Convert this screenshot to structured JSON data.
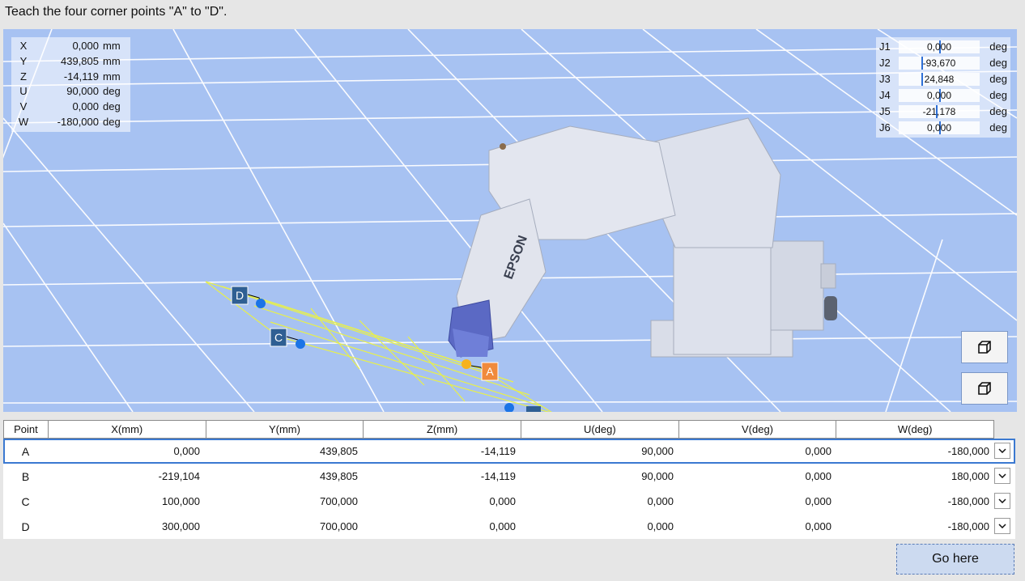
{
  "instruction": "Teach the four corner points \"A\" to \"D\".",
  "coords": [
    {
      "axis": "X",
      "value": "0,000",
      "unit": "mm"
    },
    {
      "axis": "Y",
      "value": "439,805",
      "unit": "mm"
    },
    {
      "axis": "Z",
      "value": "-14,119",
      "unit": "mm"
    },
    {
      "axis": "U",
      "value": "90,000",
      "unit": "deg"
    },
    {
      "axis": "V",
      "value": "0,000",
      "unit": "deg"
    },
    {
      "axis": "W",
      "value": "-180,000",
      "unit": "deg"
    }
  ],
  "joints": [
    {
      "name": "J1",
      "value": "0,000",
      "unit": "deg"
    },
    {
      "name": "J2",
      "value": "-93,670",
      "unit": "deg"
    },
    {
      "name": "J3",
      "value": "24,848",
      "unit": "deg"
    },
    {
      "name": "J4",
      "value": "0,000",
      "unit": "deg"
    },
    {
      "name": "J5",
      "value": "-21,178",
      "unit": "deg"
    },
    {
      "name": "J6",
      "value": "0,000",
      "unit": "deg"
    }
  ],
  "scene": {
    "robot_logo": "EPSON",
    "markers": {
      "a": "A",
      "b": "B",
      "c": "C",
      "d": "D"
    },
    "colors": {
      "background": "#a7c2f2",
      "marker_blue": "#2f5f93",
      "marker_orange": "#f08a3c",
      "plane": "#e8f04a"
    }
  },
  "view_buttons": [
    {
      "icon": "cube-icon"
    },
    {
      "icon": "cube-outline-icon"
    }
  ],
  "table": {
    "columns": [
      "Point",
      "X(mm)",
      "Y(mm)",
      "Z(mm)",
      "U(deg)",
      "V(deg)",
      "W(deg)"
    ],
    "rows": [
      {
        "point": "A",
        "x": "0,000",
        "y": "439,805",
        "z": "-14,119",
        "u": "90,000",
        "v": "0,000",
        "w": "-180,000"
      },
      {
        "point": "B",
        "x": "-219,104",
        "y": "439,805",
        "z": "-14,119",
        "u": "90,000",
        "v": "0,000",
        "w": "180,000"
      },
      {
        "point": "C",
        "x": "100,000",
        "y": "700,000",
        "z": "0,000",
        "u": "0,000",
        "v": "0,000",
        "w": "-180,000"
      },
      {
        "point": "D",
        "x": "300,000",
        "y": "700,000",
        "z": "0,000",
        "u": "0,000",
        "v": "0,000",
        "w": "-180,000"
      }
    ],
    "selected_row": "A"
  },
  "go_button": "Go here"
}
